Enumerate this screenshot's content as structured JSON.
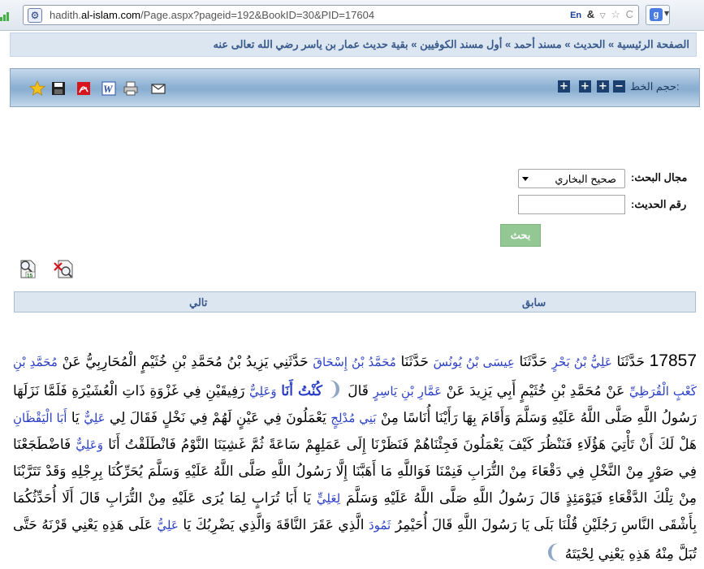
{
  "browser": {
    "url_prefix": "hadith.",
    "url_domain": "al-islam.com",
    "url_path": "/Page.aspx?pageid=192&BookID=30&PID=17604",
    "tools": [
      "En",
      "&",
      "☆",
      "C"
    ],
    "google_letter": "g"
  },
  "breadcrumb": {
    "text": "الصفحة الرئيسية » الحديث » مسند أحمد » أول مسند الكوفيين » بقية حديث عمار بن ياسر رضي الله تعالى عنه"
  },
  "toolbar": {
    "font_size_label": "حجم الخط:",
    "font_buttons": [
      "−",
      "+",
      "+",
      "+"
    ],
    "icons": [
      "email-icon",
      "print-icon",
      "word-icon",
      "pdf-icon",
      "save-icon",
      "favorite-star-icon"
    ]
  },
  "search": {
    "scope_label": "مجال البحث:",
    "scope_value": "صحيح البخاري",
    "hadith_number_label": "رقم الحديث:",
    "hadith_number_value": "",
    "button_label": "بحث"
  },
  "nav": {
    "prev_label": "سابق",
    "next_label": "تالي"
  },
  "hadith": {
    "number": "17857",
    "t1": "حَدَّثَنَا",
    "n1": "عَلِيُّ بْنُ بَحْرٍ",
    "t2": "حَدَّثَنَا",
    "n2": "عِيسَى بْنُ يُونُسَ",
    "t3": "حَدَّثَنَا",
    "n3": "مُحَمَّدُ بْنُ إِسْحَاقَ",
    "t4": "حَدَّثَنِي يَزِيدُ بْنُ مُحَمَّدِ بْنِ خُثَيْمٍ الْمُحَارِبِيُّ عَنْ",
    "n4": "مُحَمَّدِ بْنِ كَعْبٍ الْقُرَظِيِّ",
    "t5": "عَنْ مُحَمَّدِ بْنِ خُثَيْمٍ أَبِي يَزِيدَ عَنْ",
    "n5": "عَمَّارِ بْنِ يَاسِرٍ",
    "t6": "قَالَ",
    "h1": "كُنْتُ أَنَا",
    "t7": "وَعَلِيٌّ",
    "t8": "رَفِيقَيْنِ فِي غَزْوَةِ ذَاتِ الْعُشَيْرَةِ فَلَمَّا نَزَلَهَا رَسُولُ اللَّهِ صَلَّى اللَّهُ عَلَيْهِ وَسَلَّمَ وَأَقَامَ بِهَا رَأَيْنَا أُنَاسًا مِنْ",
    "n6": "بَنِي مُدْلِجٍ",
    "t9": "يَعْمَلُونَ فِي عَيْنٍ لَهُمْ فِي نَخْلٍ فَقَالَ لِي",
    "n7": "عَلِيٌّ",
    "t10": "يَا",
    "n8": "أَبَا الْيَقْظَانِ",
    "t11": "هَلْ لَكَ أَنْ تَأْتِيَ هَؤُلَاءِ فَنَنْظُرَ كَيْفَ يَعْمَلُونَ فَجِئْنَاهُمْ فَنَظَرْنَا إِلَى عَمَلِهِمْ سَاعَةً ثُمَّ غَشِيَنَا النَّوْمُ فَانْطَلَقْتُ أَنَا",
    "n9": "وَعَلِيٌّ",
    "t12": "فَاضْطَجَعْنَا فِي صَوْرٍ مِنْ النَّخْلِ فِي دَقْعَاءَ مِنْ التُّرَابِ فَنِمْنَا فَوَاللَّهِ مَا أَهَبَّنَا إِلَّا رَسُولُ اللَّهِ صَلَّى اللَّهُ عَلَيْهِ وَسَلَّمَ يُحَرِّكُنَا بِرِجْلِهِ وَقَدْ تَتَرَّبْنَا مِنْ تِلْكَ الدَّقْعَاءِ فَيَوْمَئِذٍ قَالَ رَسُولُ اللَّهِ صَلَّى اللَّهُ عَلَيْهِ وَسَلَّمَ",
    "n10": "لِعَلِيٍّ",
    "t13": "يَا أَبَا تُرَابٍ لِمَا يُرَى عَلَيْهِ مِنْ التُّرَابِ قَالَ أَلَا أُحَدِّثُكُمَا بِأَشْقَى النَّاسِ رَجُلَيْنِ قُلْنَا بَلَى يَا رَسُولَ اللَّهِ قَالَ أُحَيْمِرُ",
    "n11": "ثَمُودَ",
    "t14": "الَّذِي عَقَرَ النَّاقَةَ وَالَّذِي يَضْرِبُكَ يَا",
    "n12": "عَلِيُّ",
    "t15": "عَلَى هَذِهِ يَعْنِي قَرْنَهُ حَتَّى تُبَلَّ مِنْهُ هَذِهِ يَعْنِي لِحْيَتَهُ"
  }
}
